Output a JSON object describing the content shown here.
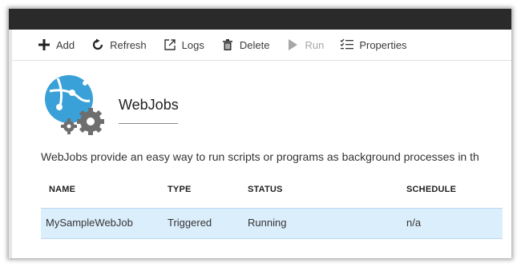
{
  "toolbar": {
    "add": "Add",
    "refresh": "Refresh",
    "logs": "Logs",
    "delete": "Delete",
    "run": "Run",
    "properties": "Properties"
  },
  "header": {
    "title": "WebJobs"
  },
  "description": "WebJobs provide an easy way to run scripts or programs as background processes in th",
  "table": {
    "columns": [
      "NAME",
      "TYPE",
      "STATUS",
      "SCHEDULE"
    ],
    "rows": [
      {
        "name": "MySampleWebJob",
        "type": "Triggered",
        "status": "Running",
        "schedule": "n/a"
      }
    ]
  },
  "colors": {
    "topbar": "#2a2a2a",
    "selected_row": "#dbeefc",
    "icon_blue": "#3aa0d8",
    "gear_gray": "#6e6e6e",
    "disabled_text": "#a6a6a6"
  }
}
